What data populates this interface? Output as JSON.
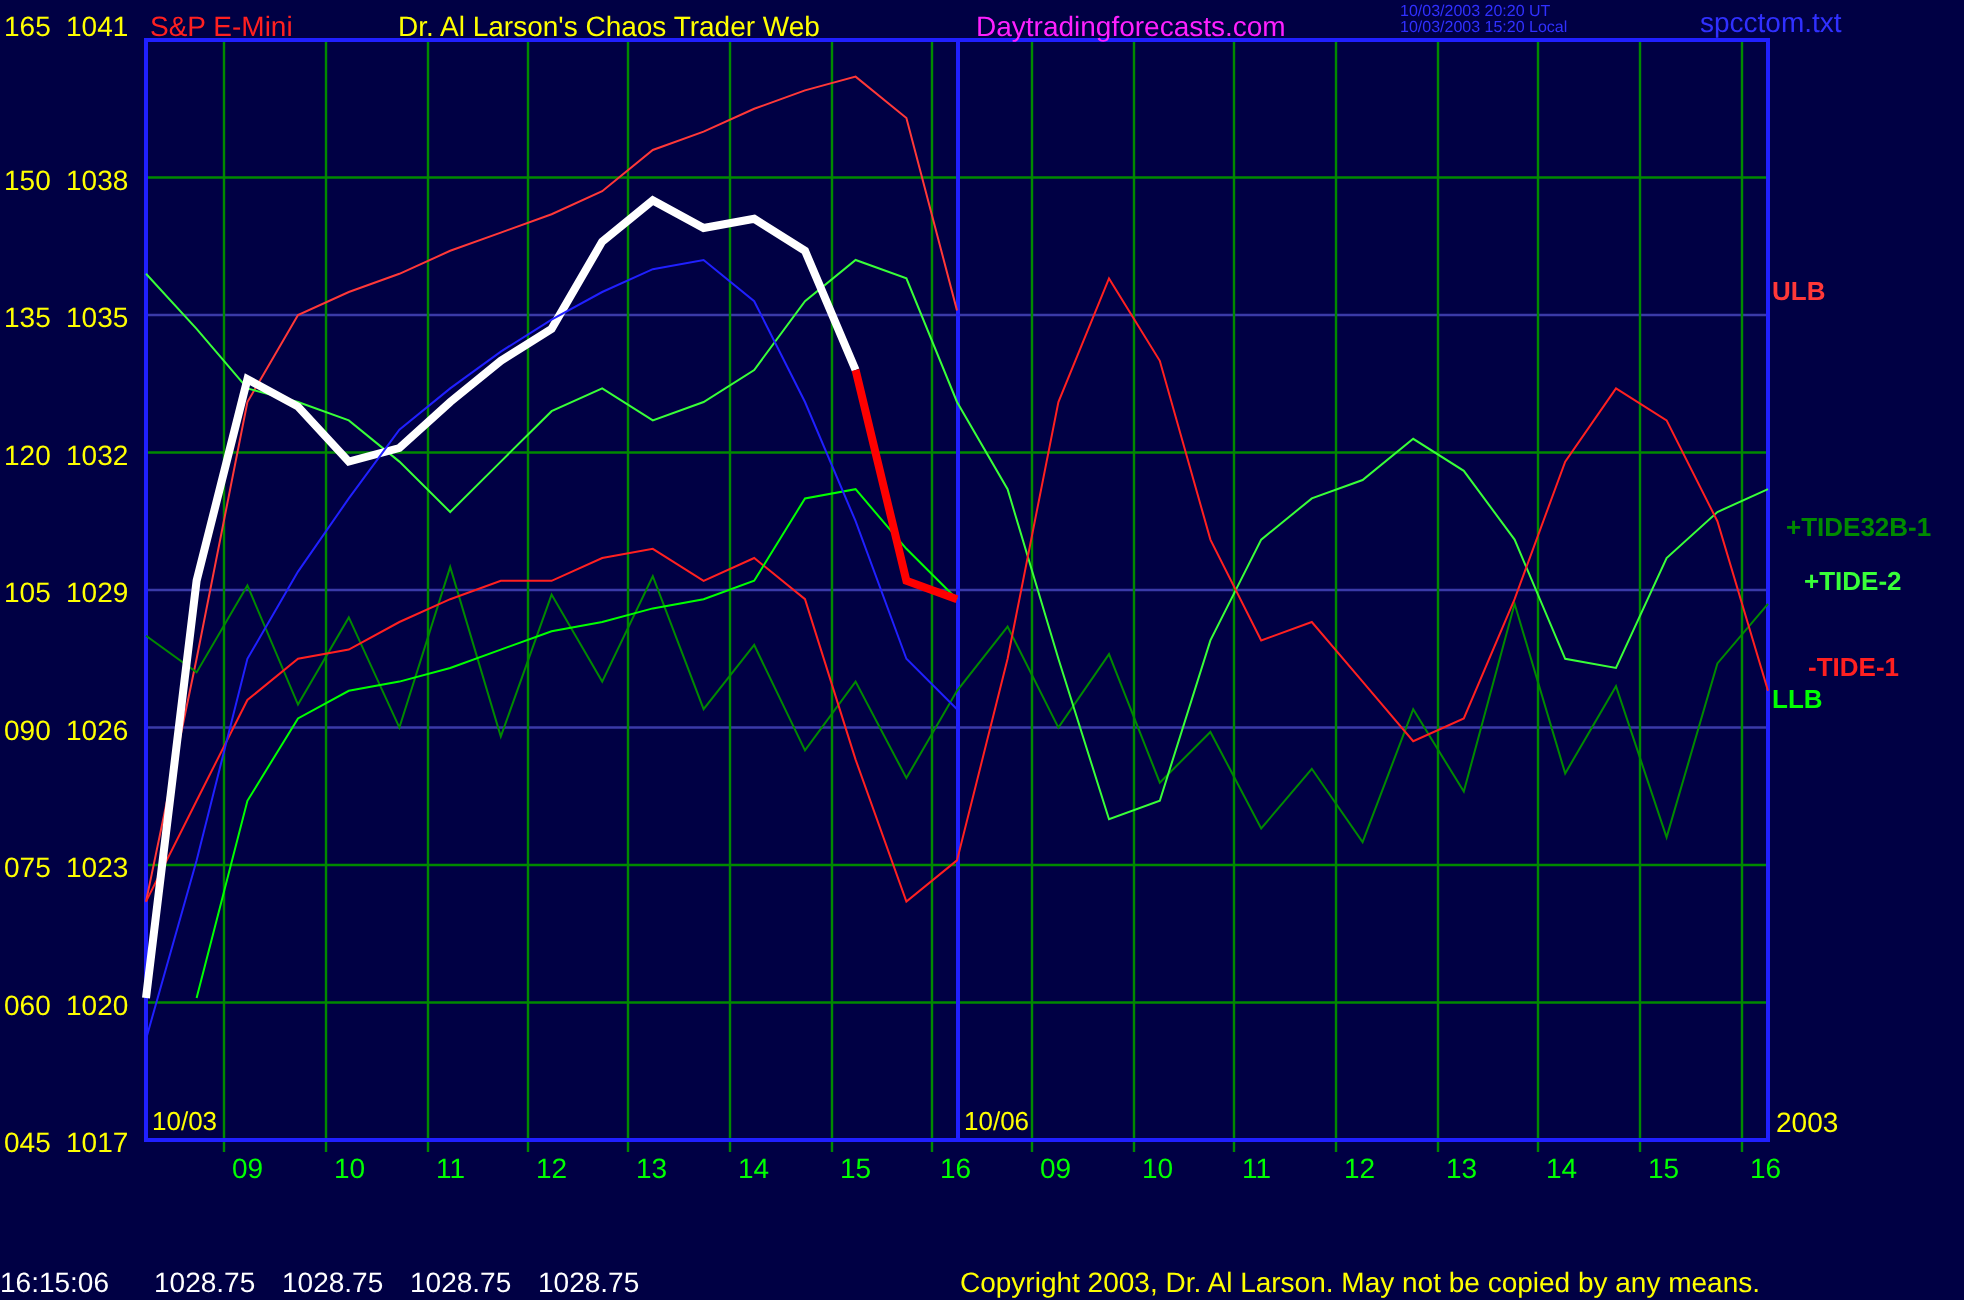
{
  "header": {
    "symbol": "S&P E-Mini",
    "title": "Dr. Al Larson's Chaos Trader Web",
    "site": "Daytradingforecasts.com",
    "timestamps": [
      "10/03/2003 20:20 UT",
      "10/03/2003 15:20 Local"
    ],
    "file": "spcctom.txt"
  },
  "left_scale": [
    "165",
    "150",
    "135",
    "120",
    "105",
    "090",
    "075",
    "060",
    "045"
  ],
  "dates": [
    "10/03",
    "10/06"
  ],
  "year": "2003",
  "hours": [
    "09",
    "10",
    "11",
    "12",
    "13",
    "14",
    "15",
    "16",
    "09",
    "10",
    "11",
    "12",
    "13",
    "14",
    "15",
    "16"
  ],
  "chart_data": {
    "type": "line",
    "grid": true,
    "categories": [
      null,
      null,
      null,
      null,
      null,
      null,
      null,
      null,
      null,
      null,
      null,
      null,
      null,
      null,
      null,
      null,
      null,
      null,
      null,
      null,
      null,
      null,
      null,
      null,
      null,
      null,
      null,
      null,
      null,
      null,
      null,
      null,
      null
    ],
    "ylim": [
      1017,
      1041
    ],
    "yticks": [
      1017,
      1020,
      1023,
      1026,
      1029,
      1032,
      1035,
      1038,
      1041
    ],
    "series": [
      {
        "name": "ULB",
        "color": "#ff3838",
        "values": [
          1022.2,
          1027.5,
          1033.1,
          1035.0,
          1035.5,
          1035.9,
          1036.4,
          1036.8,
          1037.2,
          1037.7,
          1038.6,
          1039.0,
          1039.5,
          1039.9,
          1040.2,
          1039.3,
          1035.1,
          null,
          null,
          null,
          null,
          null,
          null,
          null,
          null,
          null,
          null,
          null,
          null,
          null,
          null,
          null,
          null
        ]
      },
      {
        "name": "+TIDE32B-1",
        "color": "#008a00",
        "values": [
          1028.0,
          1027.2,
          1029.1,
          1026.5,
          1028.4,
          1026.0,
          1029.5,
          1025.8,
          1028.9,
          1027.0,
          1029.3,
          1026.4,
          1027.8,
          1025.5,
          1027.0,
          1024.9,
          1026.8,
          1028.2,
          1026.0,
          1027.6,
          1024.8,
          1025.9,
          1023.8,
          1025.1,
          1023.5,
          1026.4,
          1024.6,
          1028.7,
          1025.0,
          1026.9,
          1023.6,
          1027.4,
          1028.7
        ]
      },
      {
        "name": "+TIDE-2",
        "color": "#38ff38",
        "values": [
          1035.9,
          1034.7,
          1033.4,
          1033.1,
          1032.7,
          1031.8,
          1030.7,
          1031.8,
          1032.9,
          1033.4,
          1032.7,
          1033.1,
          1033.8,
          1035.3,
          1036.2,
          1035.8,
          1033.1,
          1031.2,
          1027.5,
          1024.0,
          1024.4,
          1027.9,
          1030.1,
          1031.0,
          1031.4,
          1032.3,
          1031.6,
          1030.1,
          1027.5,
          1027.3,
          1029.7,
          1030.7,
          1031.2
        ]
      },
      {
        "name": "-TIDE-1",
        "color": "#ff2020",
        "values": [
          1022.2,
          1024.4,
          1026.6,
          1027.5,
          1027.7,
          1028.3,
          1028.8,
          1029.2,
          1029.2,
          1029.7,
          1029.9,
          1029.2,
          1029.7,
          1028.8,
          1025.3,
          1022.2,
          1023.1,
          1027.5,
          1033.1,
          1035.8,
          1034.0,
          1030.1,
          1027.9,
          1028.3,
          1027.0,
          1025.7,
          1026.2,
          1028.8,
          1031.8,
          1033.4,
          1032.7,
          1030.5,
          1026.8
        ]
      },
      {
        "name": "LLB",
        "color": "#00ff00",
        "values": [
          null,
          1020.1,
          1024.4,
          1026.2,
          1026.8,
          1027.0,
          1027.3,
          1027.7,
          1028.1,
          1028.3,
          1028.6,
          1028.8,
          1029.2,
          1031.0,
          1031.2,
          1029.9,
          1028.8,
          null,
          null,
          null,
          null,
          null,
          null,
          null,
          null,
          null,
          null,
          null,
          null,
          null,
          null,
          null,
          null
        ]
      },
      {
        "color": "#ffffff",
        "values": [
          1020.1,
          1029.2,
          1033.6,
          1033.0,
          1031.8,
          1032.1,
          1033.1,
          1034.0,
          1034.7,
          1036.6,
          1037.5,
          1036.9,
          1037.1,
          1036.4,
          1033.8,
          null,
          null,
          null,
          null,
          null,
          null,
          null,
          null,
          null,
          null,
          null,
          null,
          null,
          null,
          null,
          null,
          null,
          null
        ]
      },
      {
        "color": "#ff0000",
        "values": [
          null,
          null,
          null,
          null,
          null,
          null,
          null,
          null,
          null,
          null,
          null,
          null,
          null,
          null,
          1033.8,
          1029.2,
          1028.8,
          null,
          null,
          null,
          null,
          null,
          null,
          null,
          null,
          null,
          null,
          null,
          null,
          null,
          null,
          null,
          null
        ]
      },
      {
        "color": "#2020ff",
        "values": [
          1019.2,
          1023.1,
          1027.5,
          1029.4,
          1031.0,
          1032.5,
          1033.4,
          1034.2,
          1034.9,
          1035.5,
          1036.0,
          1036.2,
          1035.3,
          1033.1,
          1030.5,
          1027.5,
          1026.4,
          null,
          null,
          null,
          null,
          null,
          null,
          null,
          null,
          null,
          null,
          null,
          null,
          null,
          null,
          null,
          null
        ]
      }
    ]
  },
  "footer": {
    "time": "16:15:06",
    "quotes": [
      "1028.75",
      "1028.75",
      "1028.75",
      "1028.75"
    ],
    "copyright": "Copyright 2003, Dr. Al Larson. May not be copied by any means."
  }
}
